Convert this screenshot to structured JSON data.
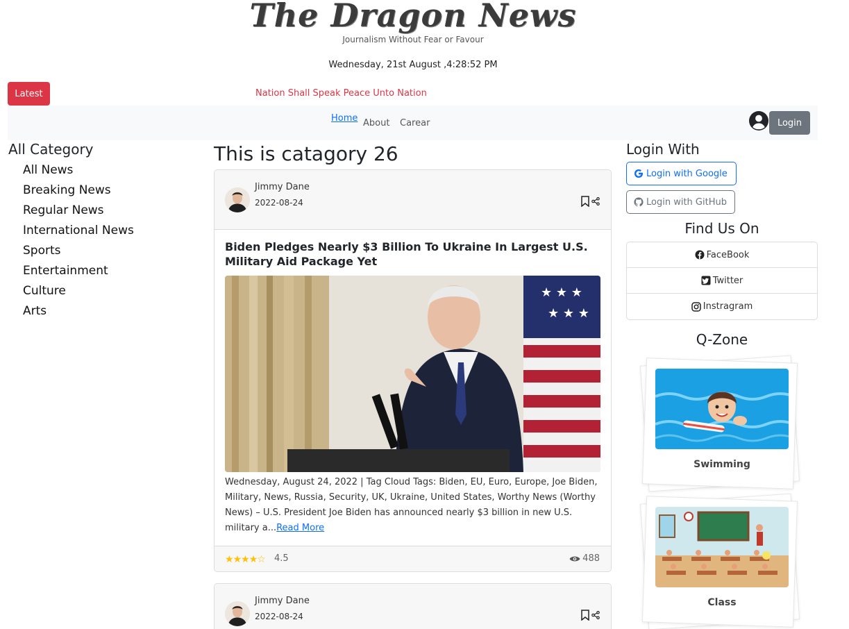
{
  "header": {
    "logo": "The Dragon News",
    "tagline": "Journalism Without Fear or Favour",
    "date": "Wednesday, 21st August ,4:28:52 PM"
  },
  "ticker": {
    "button": "Latest",
    "text": "Nation Shall Speak Peace Unto Nation"
  },
  "nav": {
    "links": [
      "Home",
      "About",
      "Carear"
    ],
    "login": "Login",
    "user_icon": "user-circle-icon"
  },
  "left": {
    "title": "All Category",
    "categories": [
      "All News",
      "Breaking News",
      "Regular News",
      "International News",
      "Sports",
      "Entertainment",
      "Culture",
      "Arts"
    ]
  },
  "main": {
    "title": "This is catagory 26",
    "cards": [
      {
        "author": "Jimmy Dane",
        "date": "2022-08-24",
        "title": "Biden Pledges Nearly $3 Billion To Ukraine In Largest U.S. Military Aid Package Yet",
        "text": "Wednesday, August 24, 2022 | Tag Cloud Tags: Biden, EU, Euro, Europe, Joe Biden, Military, News, Russia, Security, UK, Ukraine, United States, Worthy News (Worthy News) – U.S. President Joe Biden has announced nearly $3 billion in new U.S. military a...",
        "read_more": "Read More",
        "rating_value": 4.5,
        "rating": "4.5",
        "views": "488"
      },
      {
        "author": "Jimmy Dane",
        "date": "2022-08-24"
      }
    ]
  },
  "right": {
    "login_title": "Login With",
    "google": "Login with Google",
    "github": "Login with GitHub",
    "find_title": "Find Us On",
    "social": [
      "FaceBook",
      "Twitter",
      "Instragram"
    ],
    "qzone_title": "Q-Zone",
    "qzone": [
      "Swimming",
      "Class"
    ]
  },
  "colors": {
    "primary": "#0d6efd",
    "danger": "#dc3545",
    "secondary": "#6c757d",
    "star": "#ffc107"
  }
}
